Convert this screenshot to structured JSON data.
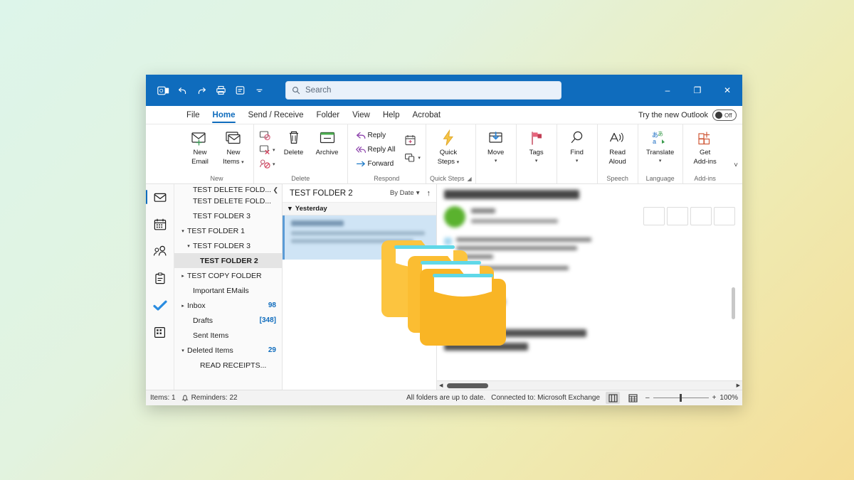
{
  "window": {
    "title_bar": {
      "app_icon": "outlook-icon",
      "quick_access": [
        {
          "name": "undo-icon",
          "label": "Undo"
        },
        {
          "name": "redo-icon",
          "label": "Redo"
        },
        {
          "name": "print-icon",
          "label": "Print"
        },
        {
          "name": "touch-mode-icon",
          "label": "Touch/Mouse Mode"
        },
        {
          "name": "customize-qat-icon",
          "label": "Customize Quick Access Toolbar"
        }
      ],
      "search_placeholder": "Search",
      "search_value": "",
      "controls": {
        "minimize": "–",
        "maximize": "❐",
        "close": "✕"
      }
    },
    "tabs": [
      {
        "label": "File",
        "active": false
      },
      {
        "label": "Home",
        "active": true
      },
      {
        "label": "Send / Receive",
        "active": false
      },
      {
        "label": "Folder",
        "active": false
      },
      {
        "label": "View",
        "active": false
      },
      {
        "label": "Help",
        "active": false
      },
      {
        "label": "Acrobat",
        "active": false
      }
    ],
    "new_outlook": {
      "label": "Try the new Outlook",
      "toggle_state": "Off"
    }
  },
  "ribbon": {
    "groups": [
      {
        "label": "New",
        "buttons": [
          {
            "name": "new-email-button",
            "line1": "New",
            "line2": "Email",
            "icon": "envelope-plus-icon"
          },
          {
            "name": "new-items-button",
            "line1": "New",
            "line2": "Items",
            "icon": "stacked-envelope-icon",
            "caret": true
          }
        ]
      },
      {
        "label": "Delete",
        "small": [
          {
            "name": "ignore-button",
            "label": "",
            "icon": "ignore-icon"
          },
          {
            "name": "clean-up-button",
            "label": "",
            "icon": "clean-up-icon",
            "caret": true
          },
          {
            "name": "junk-button",
            "label": "",
            "icon": "junk-person-icon",
            "caret": true
          }
        ],
        "buttons": [
          {
            "name": "delete-button",
            "line1": "Delete",
            "line2": "",
            "icon": "trash-icon"
          },
          {
            "name": "archive-button",
            "line1": "Archive",
            "line2": "",
            "icon": "archive-box-icon"
          }
        ]
      },
      {
        "label": "Respond",
        "small": [
          {
            "name": "reply-button",
            "label": "Reply",
            "icon": "reply-arrow-icon"
          },
          {
            "name": "reply-all-button",
            "label": "Reply All",
            "icon": "reply-all-arrow-icon"
          },
          {
            "name": "forward-button",
            "label": "Forward",
            "icon": "forward-arrow-icon"
          }
        ],
        "small2": [
          {
            "name": "meeting-button",
            "label": "",
            "icon": "calendar-meeting-icon"
          },
          {
            "name": "more-respond-button",
            "label": "",
            "icon": "more-respond-icon",
            "caret": true
          }
        ]
      },
      {
        "label": "Quick Steps",
        "has_launcher": true,
        "buttons": [
          {
            "name": "quick-steps-button",
            "line1": "Quick",
            "line2": "Steps",
            "icon": "lightning-bolt-icon",
            "caret": true
          }
        ]
      },
      {
        "label": "",
        "buttons": [
          {
            "name": "move-button",
            "line1": "Move",
            "line2": "",
            "icon": "move-to-folder-icon",
            "caret": true
          }
        ]
      },
      {
        "label": "",
        "buttons": [
          {
            "name": "tags-button",
            "line1": "Tags",
            "line2": "",
            "icon": "flag-tag-icon",
            "caret": true
          }
        ]
      },
      {
        "label": "",
        "buttons": [
          {
            "name": "find-button",
            "line1": "Find",
            "line2": "",
            "icon": "magnifier-icon",
            "caret": true
          }
        ]
      },
      {
        "label": "Speech",
        "buttons": [
          {
            "name": "read-aloud-button",
            "line1": "Read",
            "line2": "Aloud",
            "icon": "read-aloud-icon"
          }
        ]
      },
      {
        "label": "Language",
        "buttons": [
          {
            "name": "translate-button",
            "line1": "Translate",
            "line2": "",
            "icon": "translate-icon",
            "caret": true
          }
        ]
      },
      {
        "label": "Add-ins",
        "buttons": [
          {
            "name": "get-add-ins-button",
            "line1": "Get",
            "line2": "Add-ins",
            "icon": "get-add-ins-icon"
          }
        ]
      }
    ]
  },
  "nav_rail": [
    {
      "name": "nav-mail",
      "icon": "mail-icon",
      "active": true
    },
    {
      "name": "nav-calendar",
      "icon": "calendar-icon",
      "active": false
    },
    {
      "name": "nav-people",
      "icon": "people-icon",
      "active": false
    },
    {
      "name": "nav-tasks",
      "icon": "clipboard-tasks-icon",
      "active": false
    },
    {
      "name": "nav-todo",
      "icon": "todo-check-icon",
      "active": false
    },
    {
      "name": "nav-more-apps",
      "icon": "more-apps-icon",
      "active": false
    }
  ],
  "folder_pane": {
    "collapse_icon": "chevron-left-icon",
    "items": [
      {
        "label": "TEST DELETE FOLD...",
        "indent": 1,
        "chev": "",
        "count": "",
        "selected": false,
        "clipped": true
      },
      {
        "label": "TEST DELETE FOLD...",
        "indent": 1,
        "chev": "",
        "count": "",
        "selected": false
      },
      {
        "label": "TEST FOLDER 3",
        "indent": 1,
        "chev": "",
        "count": "",
        "selected": false
      },
      {
        "label": "TEST FOLDER 1",
        "indent": 0,
        "chev": "expanded",
        "count": "",
        "selected": false
      },
      {
        "label": "TEST FOLDER 3",
        "indent": 1,
        "chev": "expanded",
        "count": "",
        "selected": false
      },
      {
        "label": "TEST FOLDER 2",
        "indent": 2,
        "chev": "",
        "count": "",
        "selected": true
      },
      {
        "label": "TEST COPY FOLDER",
        "indent": 0,
        "chev": "collapsed",
        "count": "",
        "selected": false
      },
      {
        "label": "Important EMails",
        "indent": 1,
        "chev": "",
        "count": "",
        "selected": false
      },
      {
        "label": "Inbox",
        "indent": 0,
        "chev": "collapsed",
        "count": "98",
        "selected": false
      },
      {
        "label": "Drafts",
        "indent": 1,
        "chev": "",
        "count": "[348]",
        "selected": false
      },
      {
        "label": "Sent Items",
        "indent": 1,
        "chev": "",
        "count": "",
        "selected": false
      },
      {
        "label": "Deleted Items",
        "indent": 0,
        "chev": "expanded",
        "count": "29",
        "selected": false
      },
      {
        "label": "READ RECEIPTS...",
        "indent": 2,
        "chev": "",
        "count": "",
        "selected": false
      }
    ]
  },
  "message_list": {
    "header_title": "TEST FOLDER 2",
    "sort_label": "By Date",
    "sort_caret": "chevron-down-icon",
    "sort_direction_icon": "arrow-up-icon",
    "group_label": "Yesterday",
    "group_chevron": "chevron-down-icon",
    "rows": [
      {
        "name": "message-row-1",
        "selected": true,
        "redacted": true
      }
    ]
  },
  "reading_pane": {
    "redacted": true,
    "horizontal_scrollbar": true,
    "vertical_scrollbar": true
  },
  "overlay_graphic": {
    "name": "stacked-folders-graphic",
    "folder_color": "#f9b931",
    "folder_color_light": "#fcc94d",
    "paper_color": "#ffffff",
    "accent_color": "#5fd8e8",
    "count": 3
  },
  "status_bar": {
    "items_label": "Items: 1",
    "reminders_icon": "bell-icon",
    "reminders_label": "Reminders: 22",
    "sync_label": "All folders are up to date.",
    "connection_label": "Connected to: Microsoft Exchange",
    "view_normal_icon": "normal-view-icon",
    "view_reading_icon": "reading-view-icon",
    "zoom_out": "–",
    "zoom_in": "+",
    "zoom_level": "100%"
  }
}
